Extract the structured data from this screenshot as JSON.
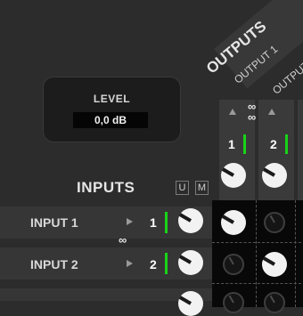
{
  "level": {
    "label": "LEVEL",
    "value": "0,0 dB"
  },
  "outputs": {
    "title": "OUTPUTS",
    "channels": [
      {
        "label": "OUTPUT 1",
        "number": "1"
      },
      {
        "label": "OUTPUT",
        "number": "2"
      }
    ]
  },
  "inputs": {
    "title": "INPUTS",
    "unmute_label": "U",
    "mute_label": "M",
    "rows": [
      {
        "label": "INPUT 1",
        "number": "1"
      },
      {
        "label": "INPUT 2",
        "number": "2"
      }
    ]
  },
  "colors": {
    "background": "#2c2c2c",
    "meter": "#19d219",
    "matrix": "#080808",
    "knob": "#f2f2f2"
  },
  "icons": {
    "link": "link-icon",
    "knob": "knob-icon",
    "triangle_up": "triangle-up-icon",
    "triangle_right": "triangle-right-icon"
  }
}
